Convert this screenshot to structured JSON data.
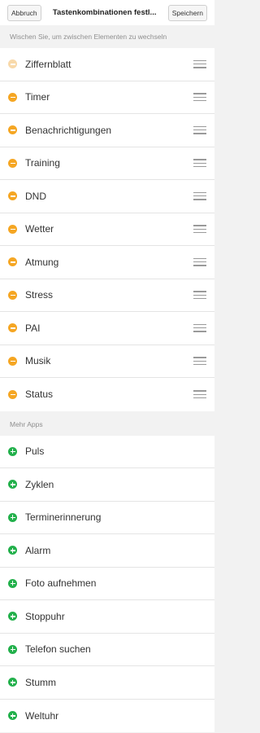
{
  "header": {
    "cancel_label": "Abbruch",
    "title": "Tastenkombinationen festl...",
    "save_label": "Speichern"
  },
  "hint": "Wischen Sie, um zwischen Elementen zu wechseln",
  "active_items": [
    {
      "label": "Ziffernblatt",
      "removable": false
    },
    {
      "label": "Timer",
      "removable": true
    },
    {
      "label": "Benachrichtigungen",
      "removable": true
    },
    {
      "label": "Training",
      "removable": true
    },
    {
      "label": "DND",
      "removable": true
    },
    {
      "label": "Wetter",
      "removable": true
    },
    {
      "label": "Atmung",
      "removable": true
    },
    {
      "label": "Stress",
      "removable": true
    },
    {
      "label": "PAI",
      "removable": true
    },
    {
      "label": "Musik",
      "removable": true
    },
    {
      "label": "Status",
      "removable": true
    }
  ],
  "more_apps_title": "Mehr Apps",
  "more_apps": [
    {
      "label": "Puls"
    },
    {
      "label": "Zyklen"
    },
    {
      "label": "Terminerinnerung"
    },
    {
      "label": "Alarm"
    },
    {
      "label": "Foto aufnehmen"
    },
    {
      "label": "Stoppuhr"
    },
    {
      "label": "Telefon suchen"
    },
    {
      "label": "Stumm"
    },
    {
      "label": "Weltuhr"
    }
  ],
  "icons": {
    "remove": "minus-circle-icon",
    "add": "plus-circle-icon",
    "drag": "drag-handle-icon"
  },
  "colors": {
    "remove": "#f5a623",
    "remove_disabled": "#f8d9aa",
    "add": "#22b04b"
  }
}
